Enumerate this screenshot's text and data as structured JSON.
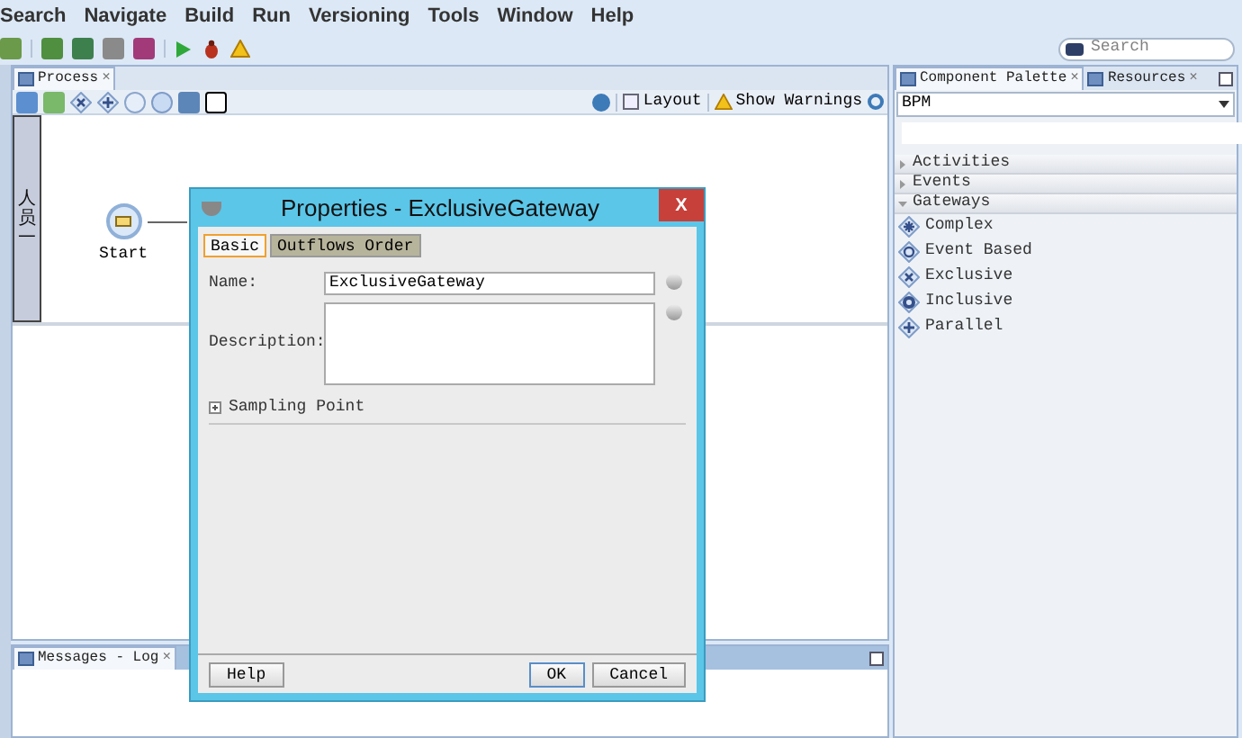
{
  "menu": [
    "Search",
    "Navigate",
    "Build",
    "Run",
    "Versioning",
    "Tools",
    "Window",
    "Help"
  ],
  "search": {
    "placeholder": "Search"
  },
  "editor": {
    "tabs": [
      {
        "label": "Process",
        "close": "×",
        "selected": true
      }
    ],
    "toolbar": [
      "Layout",
      "Show Warnings"
    ],
    "lane": "人员一",
    "start_label": "Start"
  },
  "palette": {
    "tabs": [
      {
        "label": "Component Palette",
        "close": "×",
        "selected": true
      },
      {
        "label": "Resources",
        "close": "×",
        "selected": false
      }
    ],
    "library": "BPM",
    "categories": [
      {
        "label": "Activities",
        "expanded": false
      },
      {
        "label": "Events",
        "expanded": false
      },
      {
        "label": "Gateways",
        "expanded": true,
        "children": [
          {
            "label": "Complex",
            "kind": "complex"
          },
          {
            "label": "Event Based",
            "kind": "event"
          },
          {
            "label": "Exclusive",
            "kind": "exclusive"
          },
          {
            "label": "Inclusive",
            "kind": "inclusive"
          },
          {
            "label": "Parallel",
            "kind": "parallel"
          }
        ]
      }
    ]
  },
  "log": {
    "tabs": [
      {
        "label": "Messages - Log",
        "close": "×",
        "selected": true
      }
    ]
  },
  "dialog": {
    "title": "Properties - ExclusiveGateway",
    "close": "X",
    "tabs": [
      {
        "label": "Basic",
        "selected": true
      },
      {
        "label": "Outflows Order",
        "selected": false
      }
    ],
    "fields": [
      {
        "label": "Name:",
        "value": "ExclusiveGateway",
        "kind": "line"
      },
      {
        "label": "Description:",
        "kind": "area"
      }
    ],
    "section": {
      "label": "Sampling Point",
      "expanded": false
    },
    "buttons": [
      {
        "label": "Help",
        "default": false
      },
      {
        "label": "OK",
        "default": true
      },
      {
        "label": "Cancel",
        "default": false
      }
    ]
  }
}
